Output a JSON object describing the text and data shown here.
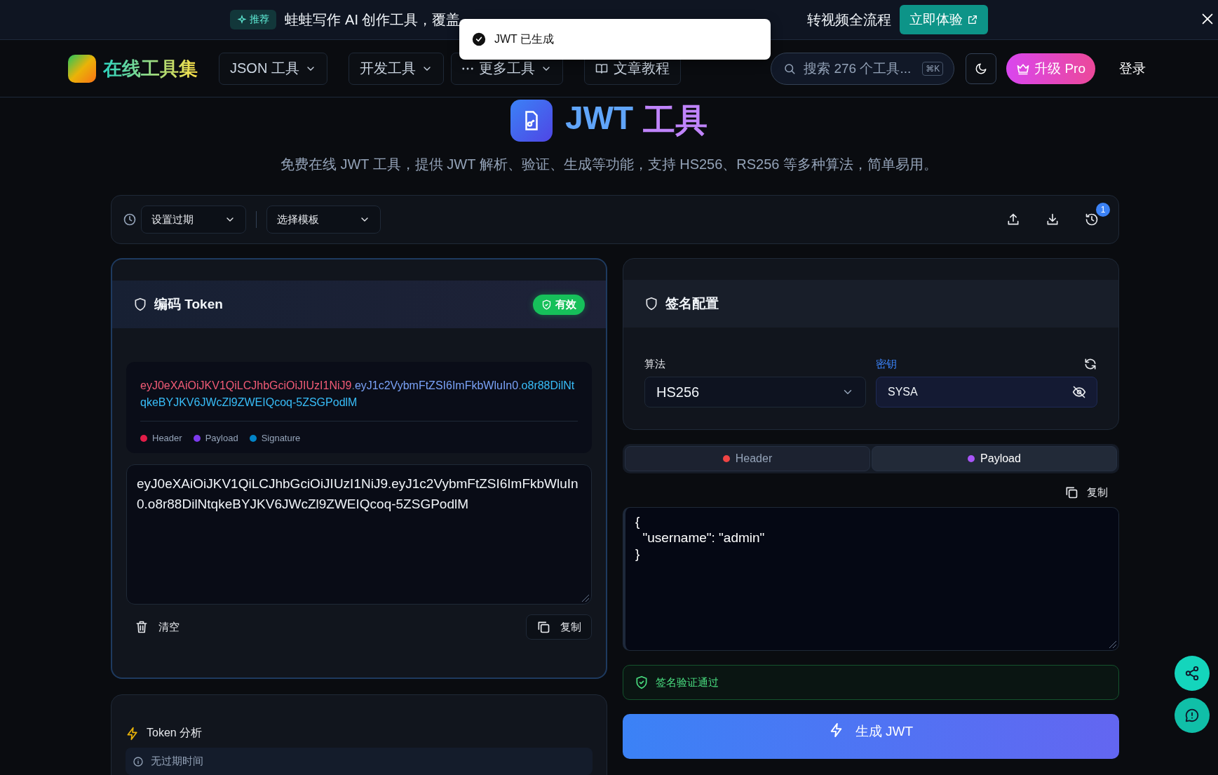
{
  "banner": {
    "badge": "推荐",
    "text_left": "蛙蛙写作 AI 创作工具，覆盖",
    "text_right": "转视频全流程",
    "cta": "立即体验"
  },
  "toast": {
    "message": "JWT 已生成"
  },
  "nav": {
    "logo": "在线工具集",
    "menus": [
      {
        "label": "JSON 工具",
        "kind": "dropdown"
      },
      {
        "label": "开发工具",
        "kind": "dropdown"
      },
      {
        "label": "更多工具",
        "kind": "more"
      },
      {
        "label": "文章教程",
        "kind": "book"
      }
    ],
    "search": {
      "placeholder": "搜索 276 个工具...",
      "shortcut": "⌘K"
    },
    "upgrade": "升级 Pro",
    "login": "登录"
  },
  "hero": {
    "title_prefix": "JWT",
    "title_suffix": "工具",
    "subtitle": "免费在线 JWT 工具，提供 JWT 解析、验证、生成等功能，支持 HS256、RS256 等多种算法，简单易用。"
  },
  "toolbar": {
    "expiry": "设置过期",
    "template": "选择模板",
    "history_count": "1"
  },
  "encode": {
    "title": "编码 Token",
    "status": "有效",
    "token_parts": [
      {
        "kind": "segment",
        "text": "eyJ0eXAiOiJKV1QiLCJhbGciOiJIUzI1NiJ9",
        "color": "#f25b76"
      },
      {
        "kind": "separator",
        "text": "."
      },
      {
        "kind": "segment",
        "text": "eyJ1c2VybmFtZSI6ImFkbWluIn0",
        "color": "#7aa2f7"
      },
      {
        "kind": "separator",
        "text": "."
      },
      {
        "kind": "segment",
        "text": "o8r88DilNtqkeBYJKV6JWcZl9ZWEIQcoq-5ZSGPodlM",
        "color": "#38bdf8"
      }
    ],
    "legend": [
      {
        "label": "Header",
        "color": "#e11d48"
      },
      {
        "label": "Payload",
        "color": "#7c3aed"
      },
      {
        "label": "Signature",
        "color": "#0284c7"
      }
    ],
    "token": "eyJ0eXAiOiJKV1QiLCJhbGciOiJIUzI1NiJ9.eyJ1c2VybmFtZSI6ImFkbWluIn0.o8r88DilNtqkeBYJKV6JWcZl9ZWEIQcoq-5ZSGPodlM",
    "clear": "清空",
    "copy": "复制"
  },
  "analysis": {
    "title": "Token 分析",
    "items": [
      "无过期时间"
    ]
  },
  "signature": {
    "title": "签名配置",
    "algorithm_label": "算法",
    "algorithm": "HS256",
    "secret_label": "密钥",
    "secret": "SYSA"
  },
  "tabs": [
    {
      "label": "Header",
      "color": "#ef4444",
      "selected": false
    },
    {
      "label": "Payload",
      "color": "#a855f7",
      "selected": true
    }
  ],
  "payload": {
    "copy": "复制",
    "text": "{\n  \"username\": \"admin\"\n}"
  },
  "verification": {
    "text": "签名验证通过"
  },
  "generate": "生成 JWT"
}
